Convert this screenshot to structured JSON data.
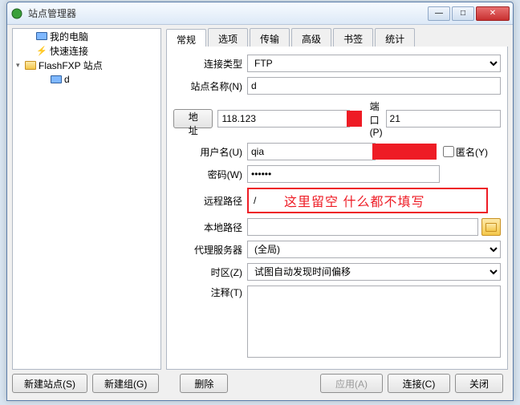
{
  "window": {
    "title": "站点管理器"
  },
  "tree": {
    "items": [
      {
        "label": "我的电脑",
        "icon": "monitor",
        "arrow": ""
      },
      {
        "label": "快速连接",
        "icon": "bolt",
        "arrow": ""
      },
      {
        "label": "FlashFXP 站点",
        "icon": "folder",
        "arrow": "▾"
      },
      {
        "label": "d",
        "icon": "monitor",
        "arrow": ""
      }
    ]
  },
  "tabs": [
    "常规",
    "选项",
    "传输",
    "高级",
    "书签",
    "统计"
  ],
  "form": {
    "connType_lbl": "连接类型",
    "connType_val": "FTP",
    "siteName_lbl": "站点名称(N)",
    "siteName_val": "d",
    "addr_btn": "地址",
    "addr_val": "118.123",
    "port_lbl": "端口(P)",
    "port_val": "21",
    "user_lbl": "用户名(U)",
    "user_val": "qia",
    "anon_lbl": "匿名(Y)",
    "pass_lbl": "密码(W)",
    "pass_val": "••••••",
    "remote_lbl": "远程路径",
    "remote_val": "/",
    "remote_note": "这里留空 什么都不填写",
    "local_lbl": "本地路径",
    "local_val": "",
    "proxy_lbl": "代理服务器",
    "proxy_val": "(全局)",
    "tz_lbl": "时区(Z)",
    "tz_val": "试图自动发现时间偏移",
    "notes_lbl": "注释(T)",
    "notes_val": ""
  },
  "buttons": {
    "newSite": "新建站点(S)",
    "newGroup": "新建组(G)",
    "delete": "删除",
    "apply": "应用(A)",
    "connect": "连接(C)",
    "close": "关闭"
  }
}
